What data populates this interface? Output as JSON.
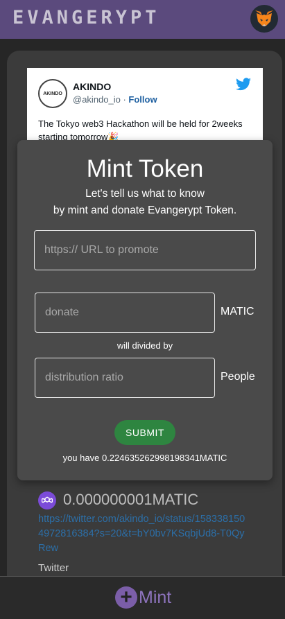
{
  "header": {
    "title": "EVANGERYPT",
    "wallet_icon": "fox-icon"
  },
  "tweet": {
    "name": "AKINDO",
    "handle": "@akindo_io",
    "separator": " · ",
    "follow": "Follow",
    "avatar_text": "AKINDO",
    "text": "The Tokyo web3 Hackathon will be held for 2weeks starting tomorrow🎉"
  },
  "modal": {
    "title": "Mint Token",
    "subtitle_line1": "Let's tell us what to know",
    "subtitle_line2": "by mint and donate Evangerypt Token.",
    "url_placeholder": "https:// URL to promote",
    "donate_placeholder": "donate",
    "donate_unit": "MATIC",
    "divided_text": "will divided by",
    "ratio_placeholder": "distribution ratio",
    "ratio_unit": "People",
    "submit": "SUBMIT",
    "balance": "you have 0.224635262998198341MATIC"
  },
  "item": {
    "amount": "0.000000001MATIC",
    "link": "https://twitter.com/akindo_io/status/1583381504972816384?s=20&t=bY0bv7KSqbjUd8-T0QyRew",
    "platform": "Twitter"
  },
  "footer": {
    "mint_label": "Mint",
    "mint_icon": "plus"
  },
  "colors": {
    "header": "#5b4a7d",
    "accent": "#7b5ea8",
    "submit": "#2e8540",
    "link": "#2c6fa8"
  }
}
